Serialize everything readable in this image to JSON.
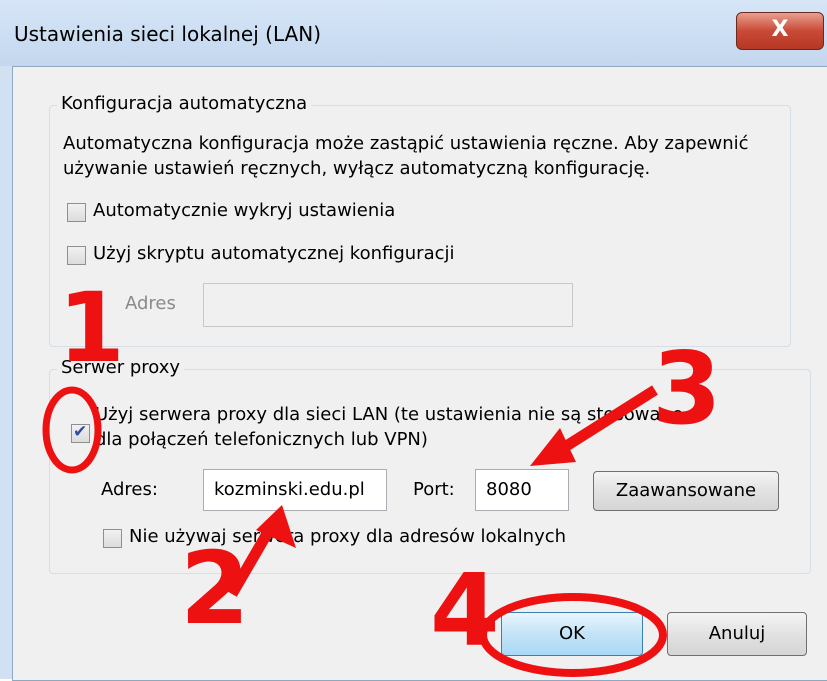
{
  "window": {
    "title": "Ustawienia sieci lokalnej (LAN)",
    "close_label": "X"
  },
  "auto_config": {
    "label": "Konfiguracja automatyczna",
    "description_line1": "Automatyczna konfiguracja może zastąpić ustawienia ręczne. Aby zapewnić",
    "description_line2": "używanie ustawień ręcznych, wyłącz automatyczną konfigurację.",
    "detect_label": "Automatycznie wykryj ustawienia",
    "detect_checked": false,
    "script_label": "Użyj skryptu automatycznej konfiguracji",
    "script_checked": false,
    "address_label": "Adres",
    "address_value": ""
  },
  "proxy": {
    "label": "Serwer proxy",
    "use_proxy_line1": "Użyj serwera proxy dla sieci LAN (te ustawienia nie są stosowane",
    "use_proxy_line2": "dla połączeń telefonicznych lub VPN)",
    "use_proxy_checked": true,
    "address_label": "Adres:",
    "address_value": "kozminski.edu.pl",
    "port_label": "Port:",
    "port_value": "8080",
    "advanced_label": "Zaawansowane",
    "bypass_label": "Nie używaj serwera proxy dla adresów lokalnych",
    "bypass_checked": false
  },
  "buttons": {
    "ok_label": "OK",
    "cancel_label": "Anuluj"
  },
  "annotations": {
    "step1": "1",
    "step2": "2",
    "step3": "3",
    "step4": "4",
    "color": "#ee1111"
  }
}
